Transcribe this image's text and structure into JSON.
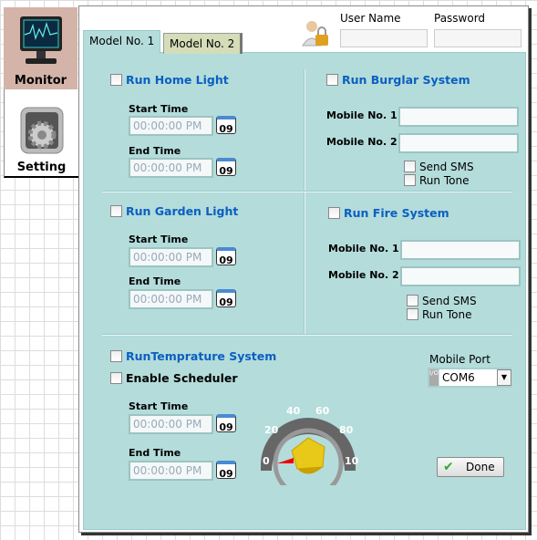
{
  "sidebar": {
    "items": [
      {
        "label": "Monitor",
        "icon": "monitor-icon"
      },
      {
        "label": "Setting",
        "icon": "gear-icon"
      }
    ]
  },
  "login": {
    "user_label": "User Name",
    "password_label": "Password",
    "user_value": "",
    "password_value": ""
  },
  "tabs": [
    {
      "label": "Model No. 1",
      "active": true
    },
    {
      "label": "Model No. 2",
      "active": false
    }
  ],
  "home_light": {
    "label": "Run Home Light",
    "start_label": "Start Time",
    "start": "00:00:00 PM",
    "end_label": "End Time",
    "end": "00:00:00 PM"
  },
  "garden_light": {
    "label": "Run Garden Light",
    "start_label": "Start Time",
    "start": "00:00:00 PM",
    "end_label": "End Time",
    "end": "00:00:00 PM"
  },
  "burglar": {
    "label": "Run Burglar System",
    "mobile1_label": "Mobile No. 1",
    "mobile2_label": "Mobile No. 2",
    "sms": "Send SMS",
    "tone": "Run Tone"
  },
  "fire": {
    "label": "Run Fire System",
    "mobile1_label": "Mobile No. 1",
    "mobile2_label": "Mobile No. 2",
    "sms": "Send SMS",
    "tone": "Run Tone"
  },
  "temperature": {
    "label": "RunTemprature System",
    "scheduler": "Enable Scheduler",
    "start_label": "Start Time",
    "start": "00:00:00 PM",
    "end_label": "End Time",
    "end": "00:00:00 PM",
    "gauge": {
      "ticks": [
        "0",
        "20",
        "40",
        "60",
        "80",
        "10"
      ],
      "value": 0
    }
  },
  "port": {
    "label": "Mobile Port",
    "value": "COM6"
  },
  "calendar_text": "09",
  "done_label": "Done",
  "colors": {
    "panel": "#b4dcdb",
    "title": "#0a5fc0"
  }
}
